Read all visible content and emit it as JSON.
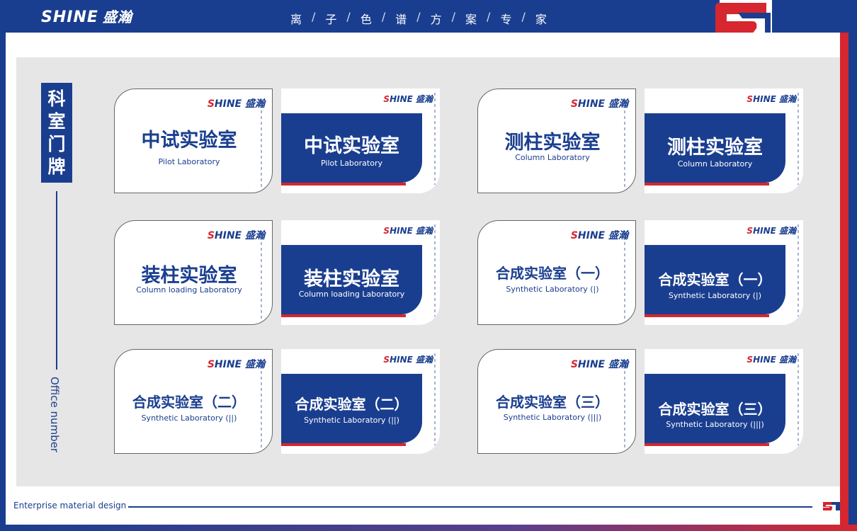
{
  "header": {
    "brand_en": "SHINE",
    "brand_cn": "盛瀚",
    "slogan": [
      "离",
      "子",
      "色",
      "谱",
      "方",
      "案",
      "专",
      "家"
    ]
  },
  "section": {
    "title_cn": [
      "科",
      "室",
      "门",
      "牌"
    ],
    "title_en": "Office number"
  },
  "footer": {
    "text": "Enterprise material design"
  },
  "logo_text": {
    "en": "SHINE",
    "cn": "盛瀚"
  },
  "signs": [
    {
      "cn": "中试实验室",
      "en": "Pilot Laboratory"
    },
    {
      "cn": "测柱实验室",
      "en": "Column Laboratory"
    },
    {
      "cn": "装柱实验室",
      "en": "Column loading Laboratory"
    },
    {
      "cn": "合成实验室（一）",
      "en": "Synthetic Laboratory (|)"
    },
    {
      "cn": "合成实验室（二）",
      "en": "Synthetic Laboratory (||)"
    },
    {
      "cn": "合成实验室（三）",
      "en": "Synthetic Laboratory (|||)"
    }
  ],
  "colors": {
    "navy": "#1a3e8f",
    "red": "#d6262f",
    "panel": "#e6e6e6"
  }
}
